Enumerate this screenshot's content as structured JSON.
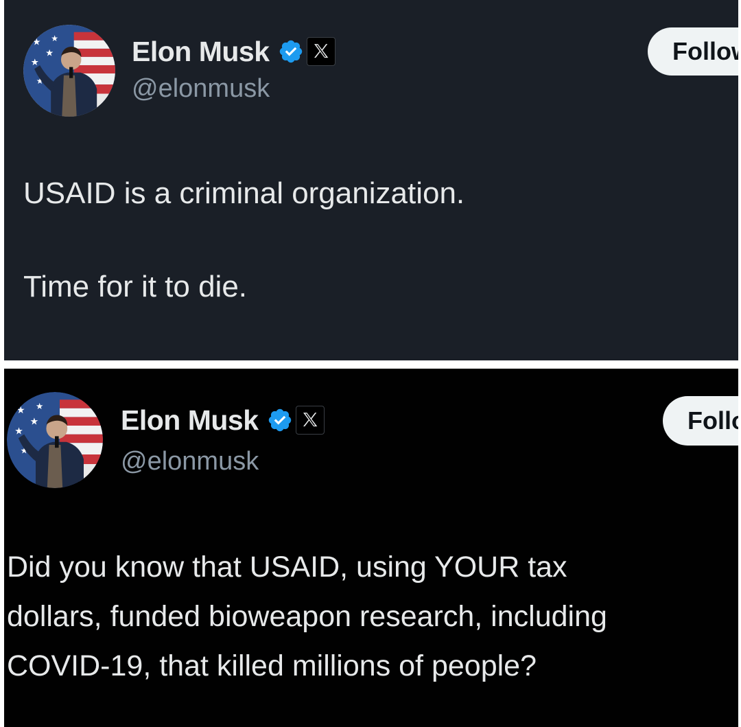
{
  "posts": [
    {
      "author": {
        "display_name": "Elon Musk",
        "handle": "@elonmusk",
        "avatar_icon": "avatar-photo-icon",
        "verified_icon": "verified-badge-icon",
        "affiliate_icon": "x-logo-icon"
      },
      "follow_label": "Follow",
      "text": "USAID is a criminal organization.\n\nTime for it to die.",
      "theme": {
        "background": "#1a1f27"
      }
    },
    {
      "author": {
        "display_name": "Elon Musk",
        "handle": "@elonmusk",
        "avatar_icon": "avatar-photo-icon",
        "verified_icon": "verified-badge-icon",
        "affiliate_icon": "x-logo-icon"
      },
      "follow_label": "Follow",
      "text_lines": [
        "Did you know that USAID, using YOUR tax",
        "dollars, funded bioweapon research, including",
        "COVID-19, that killed millions of people?"
      ],
      "theme": {
        "background": "#010101"
      }
    }
  ],
  "colors": {
    "verified_blue": "#1d9bf0",
    "text_primary": "#e7e9ea",
    "text_secondary": "#8b98a5",
    "follow_bg": "#eff3f4"
  }
}
